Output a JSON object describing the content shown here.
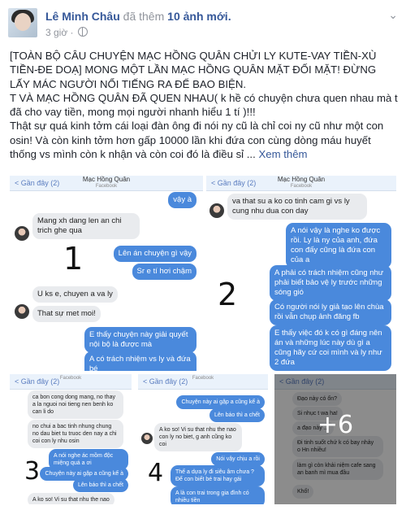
{
  "post": {
    "author": "Lê Minh Châu",
    "action": "đã thêm",
    "photos": "10 ảnh mới.",
    "time": "3 giờ ·",
    "options_icon": "chevron-down-icon",
    "text": [
      "[TOÀN BỘ CÂU CHUYỆN MẠC HỒNG QUÂN CHỬI LY KUTE-VAY TIỀN-XÙ TIỀN-ĐE DOẠ] MONG MỘT LẦN MẠC HỒNG QUÂN MẶT ĐỐI MẶT! ĐỪNG LẤY MÁC NGƯỜI NỔI TIẾNG RA ĐỂ BAO BIỆN.",
      "T VÀ MẠC HỒNG QUÂN ĐÃ QUEN NHAU( k hề có chuyện chưa quen nhau mà t đã cho vay tiền, mong mọi người nhanh hiểu 1 tí )!!!",
      "Thật sự quá kinh tởm cái loại đàn ông đi nói ny cũ là chỉ coi ny cũ như một con osin! Và còn kinh tởm hơn gấp 10000 lần khi đứa con cùng dòng máu huyết thống vs mình còn k nhận và còn coi đó là điều sỉ ... "
    ],
    "see_more": "Xem thêm"
  },
  "shots": [
    {
      "number": "1",
      "back": "< Gần đây (2)",
      "title": "Mạc Hồng Quân",
      "subtitle": "Facebook",
      "messages": [
        {
          "dir": "out",
          "text": "vậy à"
        },
        {
          "dir": "in",
          "text": "Mang xh dang len an chi trich ghe qua"
        },
        {
          "dir": "out",
          "text": "Lên án chuyện gì vậy"
        },
        {
          "dir": "out",
          "text": "Sr e tí hơi chậm"
        },
        {
          "dir": "in",
          "text": "U ks e, chuyen a va ly"
        },
        {
          "dir": "out",
          "text": "That sự met moi!"
        },
        {
          "dir": "out",
          "text": "E thấy chuyện này giải quyết nội bộ là được mà"
        },
        {
          "dir": "out",
          "text": "A có trách nhiệm vs ly và đứa bé"
        }
      ]
    },
    {
      "number": "2",
      "back": "< Gần đây (2)",
      "title": "Mạc Hồng Quân",
      "subtitle": "Facebook",
      "messages": [
        {
          "dir": "in",
          "text": "va that su a ko co tinh cam gi vs ly cung nhu dua con day"
        },
        {
          "dir": "out",
          "text": "A nói vậy là nghe ko được rồi. Ly là ny của anh, đứa con đấy cũng là đứa con của a"
        },
        {
          "dir": "out",
          "text": "A phải có trách nhiệm cũng như phải biết bảo vệ ly trước những sóng gió"
        },
        {
          "dir": "out",
          "text": "Có người nói ly giả tạo lên chùa rồi vẫn chụp ảnh đăng fb"
        },
        {
          "dir": "out",
          "text": "E thấy việc đó k có gì đáng nên án và những lúc này dù gì a cũng hãy cứ coi mình và ly như 2 đứa"
        }
      ]
    },
    {
      "number": "3",
      "back": "< Gần đây (2)",
      "title": "",
      "subtitle": "Facebook",
      "messages": [
        {
          "dir": "in",
          "text": "ca bon cong dong mang, no thay a la nguoi noi tieng nen benh ko can li do"
        },
        {
          "dir": "in",
          "text": "no chui a bac tinh nhung chung no dau biet tu truoc den nay a chi coi con ly nhu osin"
        },
        {
          "dir": "out",
          "text": "A nói nghe ác mồm độc miệng quá a ơi"
        },
        {
          "dir": "out",
          "text": "Chuyện này ai gặp a cũng kể à"
        },
        {
          "dir": "out",
          "text": "Lên báo thì a chết"
        },
        {
          "dir": "in",
          "text": "A ko so! Vi su that nhu the nao"
        }
      ]
    },
    {
      "number": "4",
      "back": "< Gần đây (2)",
      "title": "",
      "subtitle": "Facebook",
      "messages": [
        {
          "dir": "out",
          "text": "Chuyện này ai gặp a cũng kể à"
        },
        {
          "dir": "out",
          "text": "Lên báo thì a chết"
        },
        {
          "dir": "in",
          "text": "A ko so! Vi su that nhu the nao con ly no biet, g anh cũng ko coi"
        },
        {
          "dir": "out",
          "text": "Nói vậy chịu a rồi"
        },
        {
          "dir": "out",
          "text": "Thế a dựa ly đi siêu âm chưa ? Để con biết bé trai hay gái"
        },
        {
          "dir": "out",
          "text": "A là con trai trong gia đình có nhiều tiền"
        }
      ]
    },
    {
      "number": "",
      "back": "< Gần đây (2)",
      "title": "",
      "subtitle": "",
      "more": "+6",
      "messages": [
        {
          "dir": "in",
          "text": "Đạo này có ổn?"
        },
        {
          "dir": "in",
          "text": "Si nhục t wa ha!"
        },
        {
          "dir": "in",
          "text": "a đạo này ..."
        },
        {
          "dir": "in",
          "text": "Đi tinh suốt chứ k có bay nhảy o Hn nhiều!"
        },
        {
          "dir": "in",
          "text": "làm gì còn khải niệm cafe sang an banh mì mua đầu"
        },
        {
          "dir": "in",
          "text": "Khổ!"
        }
      ]
    }
  ]
}
